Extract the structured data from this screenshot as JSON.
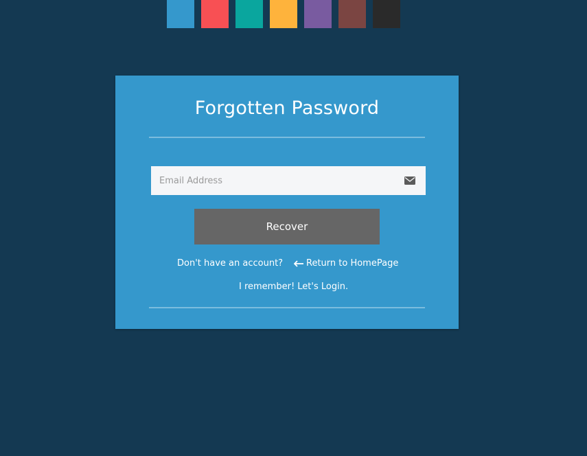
{
  "swatches": [
    {
      "name": "swatch-blue",
      "color": "#3598cc"
    },
    {
      "name": "swatch-red",
      "color": "#f85054"
    },
    {
      "name": "swatch-teal",
      "color": "#0aa69e"
    },
    {
      "name": "swatch-orange",
      "color": "#feb33c"
    },
    {
      "name": "swatch-purple",
      "color": "#795ba0"
    },
    {
      "name": "swatch-brown",
      "color": "#7b4542"
    },
    {
      "name": "swatch-dark",
      "color": "#2a2a2a"
    }
  ],
  "form": {
    "title": "Forgotten Password",
    "email_placeholder": "Email Address",
    "email_value": "",
    "email_icon": "envelope-icon",
    "recover_label": "Recover"
  },
  "links": {
    "signup": "Don't have an account?",
    "home": "Return to HomePage",
    "home_icon": "arrow-left-icon",
    "login": "I remember! Let's Login."
  },
  "colors": {
    "page_background": "#143952",
    "card_background": "#3598cc",
    "button_background": "#666666"
  }
}
